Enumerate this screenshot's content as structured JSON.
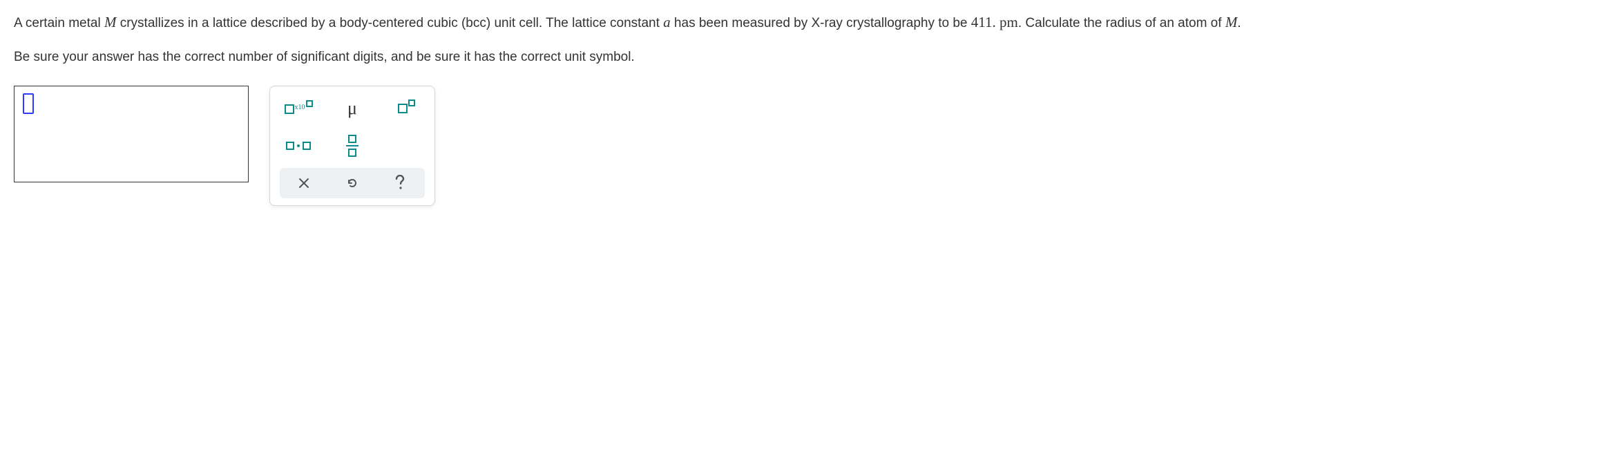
{
  "question": {
    "p1_a": "A certain metal ",
    "var_M1": "M",
    "p1_b": " crystallizes in a lattice described by a body-centered cubic (bcc) unit cell. The lattice constant ",
    "var_a": "a",
    "p1_c": " has been measured by X-ray crystallography to be ",
    "value": "411.",
    "unit": " pm",
    "p1_d": ". Calculate the radius of an atom of ",
    "var_M2": "M",
    "p1_e": ".",
    "p2": "Be sure your answer has the correct number of significant digits, and be sure it has the correct unit symbol."
  },
  "answer": {
    "value": ""
  },
  "palette": {
    "sci_label": "x10",
    "mu_label": "μ"
  }
}
